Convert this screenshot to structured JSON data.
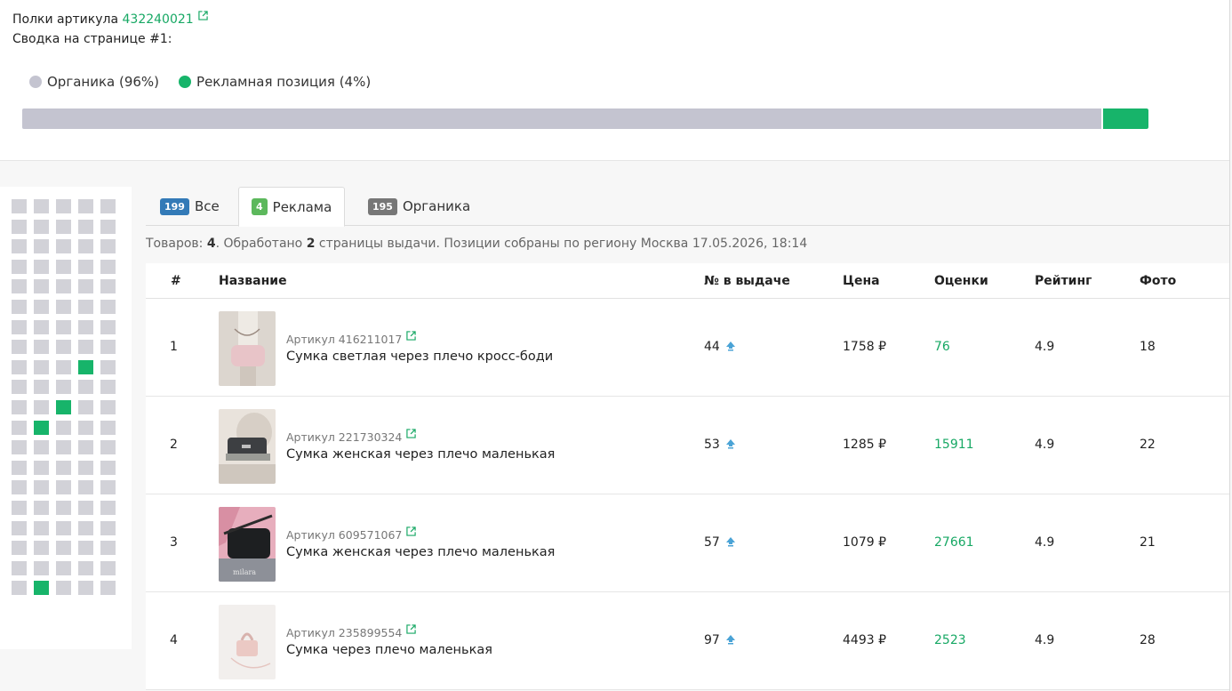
{
  "header": {
    "title_prefix": "Полки артикула",
    "article_link": "432240021",
    "summary": "Сводка на странице #1:"
  },
  "legend": {
    "organic_label": "Органика (96%)",
    "ad_label": "Рекламная позиция (4%)"
  },
  "share": {
    "organic_percent": 96,
    "ad_percent": 4
  },
  "colors": {
    "accent_green": "#17b46a",
    "organic_gray": "#c4c4d0",
    "badge_blue": "#337ab7",
    "badge_green": "#5cb85c",
    "badge_gray": "#777777"
  },
  "grid": {
    "columns": 5,
    "rows": 20,
    "ad_cells": [
      [
        8,
        3
      ],
      [
        10,
        2
      ],
      [
        11,
        1
      ],
      [
        19,
        1
      ]
    ]
  },
  "tabs": [
    {
      "count": "199",
      "label": "Все"
    },
    {
      "count": "4",
      "label": "Реклама"
    },
    {
      "count": "195",
      "label": "Органика"
    }
  ],
  "info": {
    "goods_label": "Товаров: ",
    "goods_count": "4",
    "processed_label": ". Обработано ",
    "pages_count": "2",
    "rest": " страницы выдачи. Позиции собраны по региону Москва 17.05.2026, 18:14"
  },
  "columns": {
    "num": "#",
    "name": "Название",
    "position": "№ в выдаче",
    "price": "Цена",
    "reviews": "Оценки",
    "rating": "Рейтинг",
    "photos": "Фото"
  },
  "rows": [
    {
      "num": "1",
      "sku": "Артикул 416211017",
      "name": "Сумка светлая через плечо кросс-боди",
      "position": "44",
      "price": "1758 ₽",
      "reviews": "76",
      "rating": "4.9",
      "photos": "18",
      "thumb": "pink-crossbody"
    },
    {
      "num": "2",
      "sku": "Артикул 221730324",
      "name": "Сумка женская через плечо маленькая",
      "position": "53",
      "price": "1285 ₽",
      "reviews": "15911",
      "rating": "4.9",
      "photos": "22",
      "thumb": "dark-gray-bag"
    },
    {
      "num": "3",
      "sku": "Артикул 609571067",
      "name": "Сумка женская через плечо маленькая",
      "position": "57",
      "price": "1079 ₽",
      "reviews": "27661",
      "rating": "4.9",
      "photos": "21",
      "thumb": "black-bag"
    },
    {
      "num": "4",
      "sku": "Артикул 235899554",
      "name": "Сумка через плечо маленькая",
      "position": "97",
      "price": "4493 ₽",
      "reviews": "2523",
      "rating": "4.9",
      "photos": "28",
      "thumb": "pink-handbag"
    }
  ]
}
